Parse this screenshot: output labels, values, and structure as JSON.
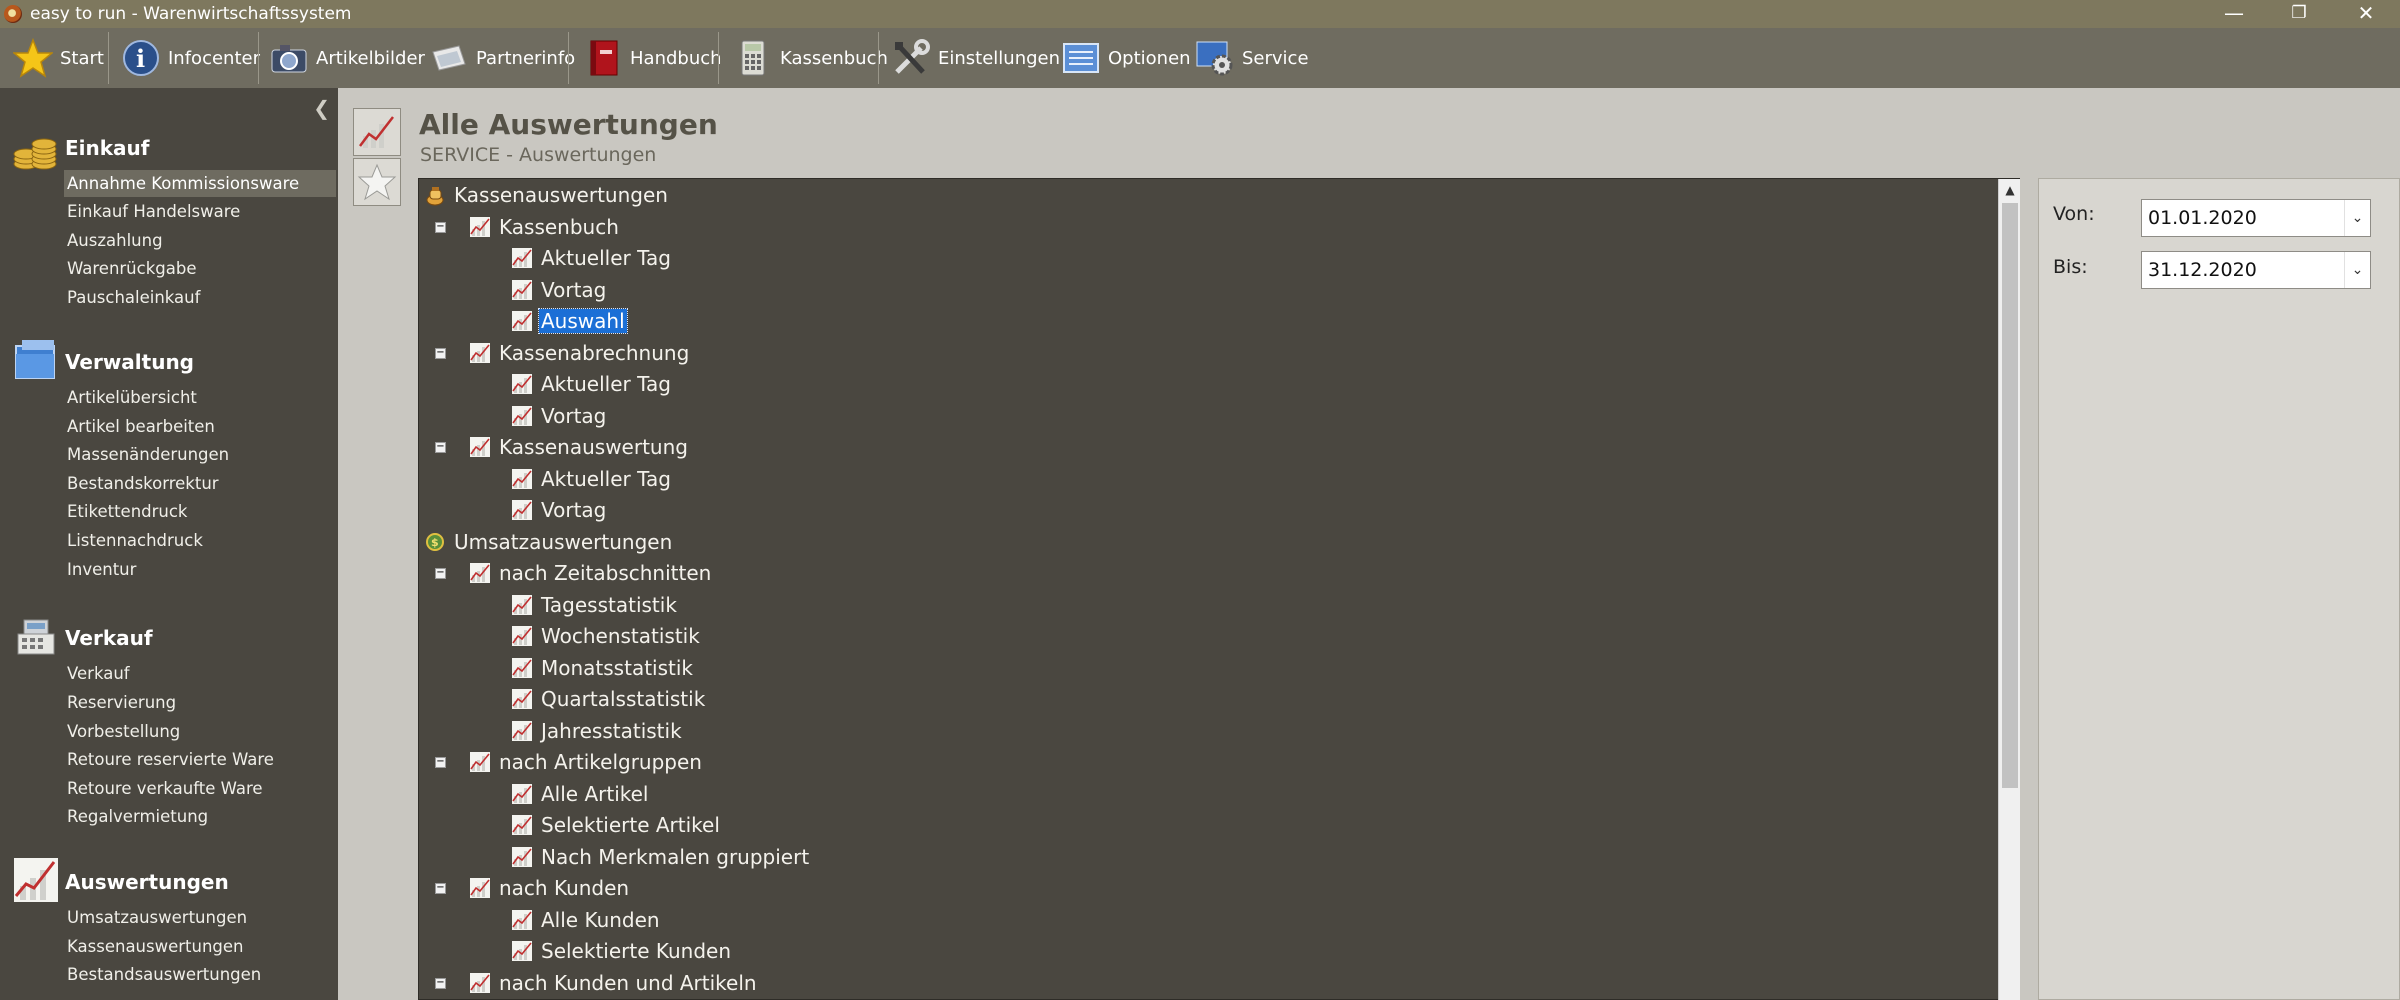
{
  "window": {
    "title": "easy to run - Warenwirtschaftssystem"
  },
  "toolbar": {
    "items": [
      {
        "label": "Start",
        "icon": "star-icon"
      },
      {
        "label": "Infocenter",
        "icon": "infocenter-icon"
      },
      {
        "label": "Artikelbilder",
        "icon": "camera-icon"
      },
      {
        "label": "Partnerinfo",
        "icon": "partnerinfo-icon"
      },
      {
        "label": "Handbuch",
        "icon": "book-icon"
      },
      {
        "label": "Kassenbuch",
        "icon": "calculator-icon"
      },
      {
        "label": "Einstellungen",
        "icon": "tools-icon"
      },
      {
        "label": "Optionen",
        "icon": "options-icon"
      },
      {
        "label": "Service",
        "icon": "service-gear-icon"
      }
    ]
  },
  "sidebar": {
    "groups": [
      {
        "title": "Einkauf",
        "icon": "coins-icon",
        "items": [
          "Annahme Kommissionsware",
          "Einkauf Handelsware",
          "Auszahlung",
          "Warenrückgabe",
          "Pauschaleinkauf"
        ]
      },
      {
        "title": "Verwaltung",
        "icon": "folder-icon",
        "items": [
          "Artikelübersicht",
          "Artikel bearbeiten",
          "Massenänderungen",
          "Bestandskorrektur",
          "Etikettendruck",
          "Listennachdruck",
          "Inventur"
        ]
      },
      {
        "title": "Verkauf",
        "icon": "cash-register-icon",
        "items": [
          "Verkauf",
          "Reservierung",
          "Vorbestellung",
          "Retoure reservierte Ware",
          "Retoure verkaufte Ware",
          "Regalvermietung"
        ]
      },
      {
        "title": "Auswertungen",
        "icon": "chart-icon",
        "items": [
          "Umsatzauswertungen",
          "Kassenauswertungen",
          "Bestandsauswertungen"
        ]
      }
    ],
    "selected_item": "Annahme Kommissionsware"
  },
  "main": {
    "title": "Alle Auswertungen",
    "subtitle": "SERVICE - Auswertungen"
  },
  "tree": [
    {
      "label": "Kassenauswertungen",
      "level": 0,
      "icon": "money-bag-icon"
    },
    {
      "label": "Kassenbuch",
      "level": 1,
      "expanded": true
    },
    {
      "label": "Aktueller Tag",
      "level": 2
    },
    {
      "label": "Vortag",
      "level": 2
    },
    {
      "label": "Auswahl",
      "level": 2,
      "selected": true
    },
    {
      "label": "Kassenabrechnung",
      "level": 1,
      "expanded": true
    },
    {
      "label": "Aktueller Tag",
      "level": 2
    },
    {
      "label": "Vortag",
      "level": 2
    },
    {
      "label": "Kassenauswertung",
      "level": 1,
      "expanded": true
    },
    {
      "label": "Aktueller Tag",
      "level": 2
    },
    {
      "label": "Vortag",
      "level": 2
    },
    {
      "label": "Umsatzauswertungen",
      "level": 0,
      "icon": "revenue-icon"
    },
    {
      "label": "nach Zeitabschnitten",
      "level": 1,
      "expanded": true
    },
    {
      "label": "Tagesstatistik",
      "level": 2
    },
    {
      "label": "Wochenstatistik",
      "level": 2
    },
    {
      "label": "Monatsstatistik",
      "level": 2
    },
    {
      "label": "Quartalsstatistik",
      "level": 2
    },
    {
      "label": "Jahresstatistik",
      "level": 2
    },
    {
      "label": "nach Artikelgruppen",
      "level": 1,
      "expanded": true
    },
    {
      "label": "Alle Artikel",
      "level": 2
    },
    {
      "label": "Selektierte Artikel",
      "level": 2
    },
    {
      "label": "Nach Merkmalen gruppiert",
      "level": 2
    },
    {
      "label": "nach Kunden",
      "level": 1,
      "expanded": true
    },
    {
      "label": "Alle Kunden",
      "level": 2
    },
    {
      "label": "Selektierte Kunden",
      "level": 2
    },
    {
      "label": "nach Kunden und Artikeln",
      "level": 1,
      "expanded": true
    }
  ],
  "filter": {
    "von_label": "Von:",
    "von_value": "01.01.2020",
    "bis_label": "Bis:",
    "bis_value": "31.12.2020"
  },
  "colors": {
    "toolbar": "#6f6c60",
    "panel": "#4a4740",
    "selection": "#1b6fd6"
  }
}
